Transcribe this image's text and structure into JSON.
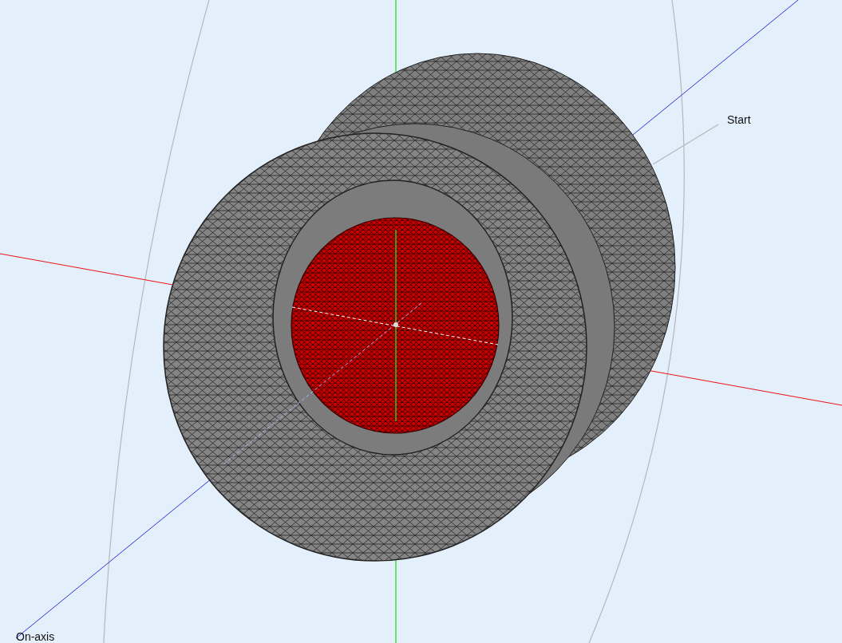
{
  "viewport": {
    "labels": [
      {
        "kind": "start",
        "text": "Start"
      },
      {
        "kind": "axis",
        "text": "On-axis"
      }
    ]
  }
}
